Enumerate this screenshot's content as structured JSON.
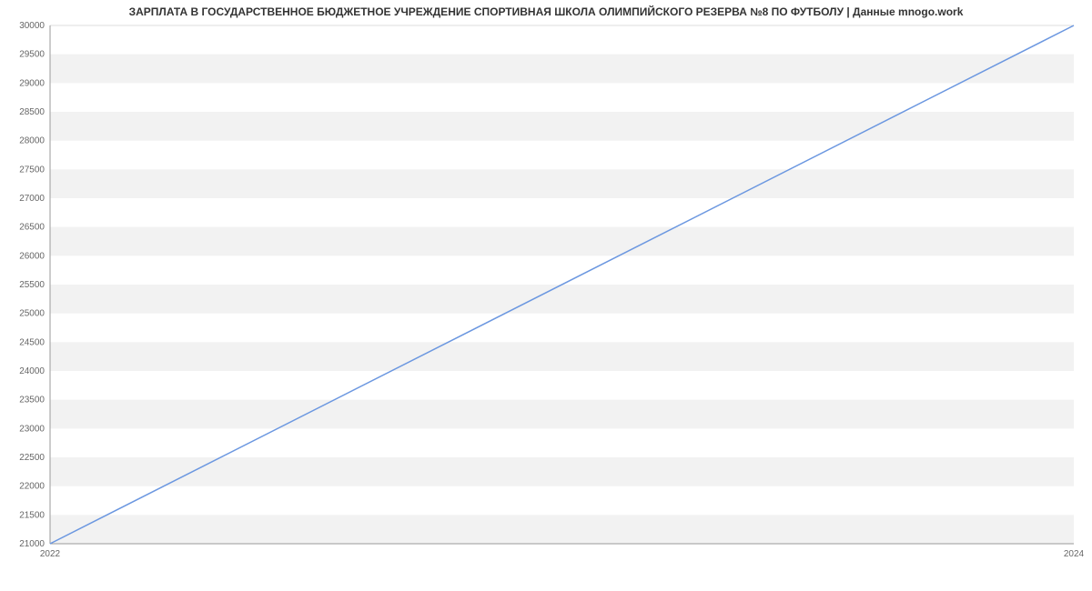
{
  "chart_data": {
    "type": "line",
    "title": "ЗАРПЛАТА В ГОСУДАРСТВЕННОЕ БЮДЖЕТНОЕ УЧРЕЖДЕНИЕ  СПОРТИВНАЯ ШКОЛА ОЛИМПИЙСКОГО РЕЗЕРВА №8 ПО ФУТБОЛУ | Данные mnogo.work",
    "x": [
      2022,
      2024
    ],
    "values": [
      21000,
      30000
    ],
    "xlabel": "",
    "ylabel": "",
    "xlim": [
      2022,
      2024
    ],
    "ylim": [
      21000,
      30000
    ],
    "x_ticks": [
      2022,
      2024
    ],
    "y_ticks": [
      21000,
      21500,
      22000,
      22500,
      23000,
      23500,
      24000,
      24500,
      25000,
      25500,
      26000,
      26500,
      27000,
      27500,
      28000,
      28500,
      29000,
      29500,
      30000
    ]
  },
  "colors": {
    "line": "#6b97e0",
    "band_alt": "#f2f2f2",
    "grid_outer": "#dcdcdc",
    "axis": "#999999"
  }
}
